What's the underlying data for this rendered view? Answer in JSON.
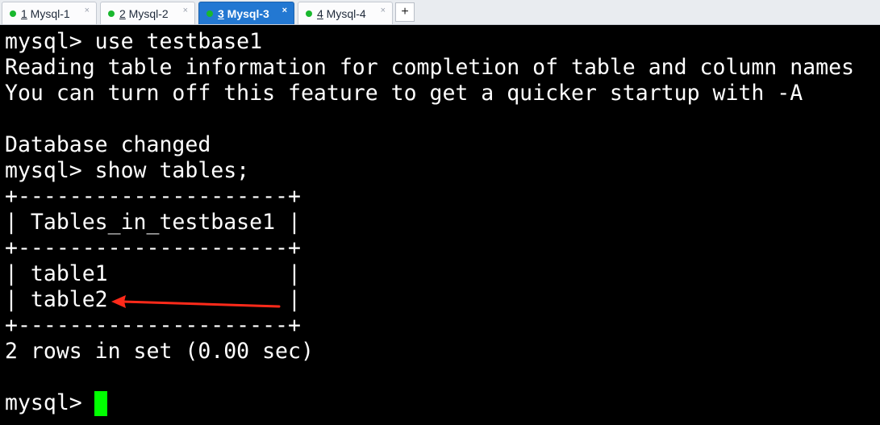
{
  "tabs": [
    {
      "number": "1",
      "title": " Mysql-1",
      "close": "×",
      "active": false
    },
    {
      "number": "2",
      "title": " Mysql-2",
      "close": "×",
      "active": false
    },
    {
      "number": "3",
      "title": " Mysql-3",
      "close": "×",
      "active": true
    },
    {
      "number": "4",
      "title": " Mysql-4",
      "close": "×",
      "active": false
    }
  ],
  "new_tab_label": "+",
  "colors": {
    "status_dot": "#19b82e",
    "active_tab": "#2378d2",
    "terminal_bg": "#000000",
    "terminal_fg": "#ffffff",
    "cursor": "#00ff00",
    "arrow": "#ff2a1a"
  },
  "terminal": {
    "lines": [
      "mysql> use testbase1",
      "Reading table information for completion of table and column names",
      "You can turn off this feature to get a quicker startup with -A",
      "",
      "Database changed",
      "mysql> show tables;",
      "+---------------------+",
      "| Tables_in_testbase1 |",
      "+---------------------+",
      "| table1              |",
      "| table2              |",
      "+---------------------+",
      "2 rows in set (0.00 sec)",
      "",
      "mysql> "
    ]
  },
  "annotation": {
    "type": "arrow",
    "icon": "red-arrow-icon",
    "points_to": "table2"
  }
}
